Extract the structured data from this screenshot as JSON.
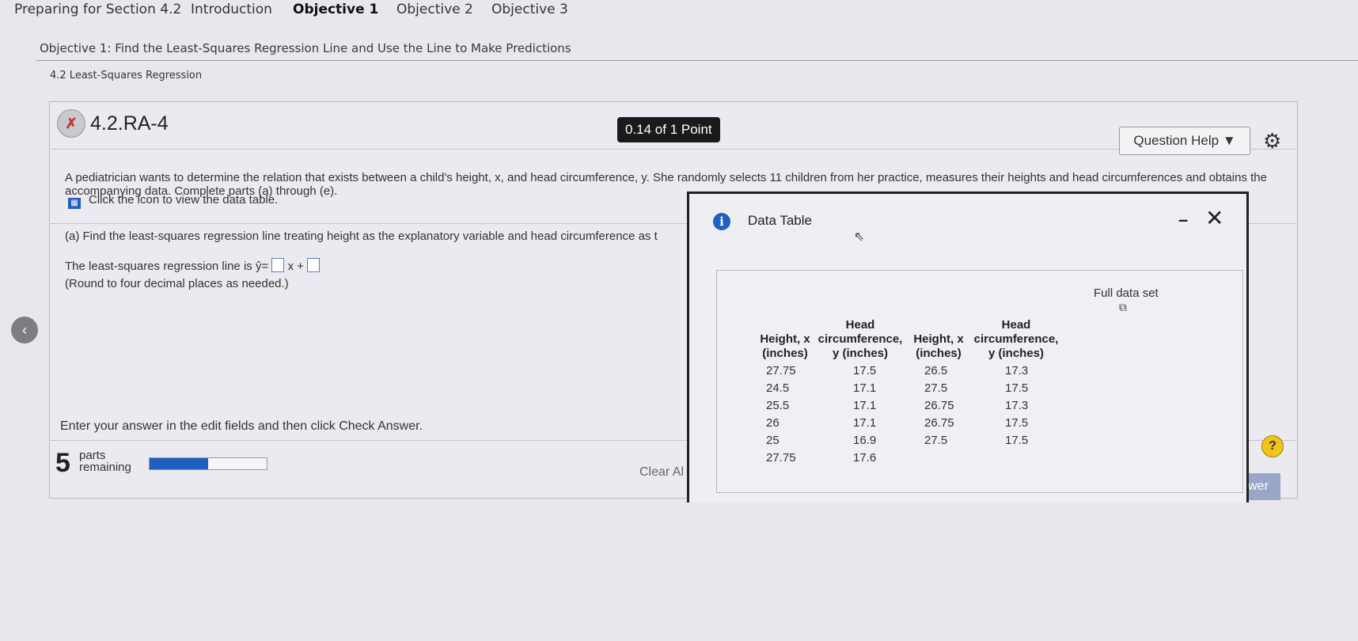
{
  "nav": {
    "tabs": [
      "Preparing for Section 4.2",
      "Introduction",
      "Objective 1",
      "Objective 2",
      "Objective 3"
    ],
    "active_tab": "Objective 1"
  },
  "objective_title": "Objective 1: Find the Least-Squares Regression Line and Use the Line to Make Predictions",
  "section_label": "4.2 Least-Squares Regression",
  "question": {
    "id": "4.2.RA-4",
    "points": "0.14 of 1 Point",
    "help_label": "Question Help",
    "prompt": "A pediatrician wants to determine the relation that exists between a child's height, x, and head circumference, y. She randomly selects 11 children from her practice, measures their heights and head circumferences and obtains the accompanying data. Complete parts (a) through (e).",
    "data_table_link": "Click the icon to view the data table.",
    "part_a": "(a) Find the least-squares regression line treating height as the explanatory variable and head circumference as t",
    "reg_line_prefix": "The least-squares regression line is",
    "yhat": "ŷ",
    "eq_sign": "=",
    "x_plus": "x +",
    "round_note": "(Round to four decimal places as needed.)",
    "enter_answer": "Enter your answer in the edit fields and then click Check Answer.",
    "parts_count": "5",
    "parts_label_1": "parts",
    "parts_label_2": "remaining",
    "progress": 0.5,
    "clear_all": "Clear Al",
    "check_partial": "wer",
    "help_symbol": "?"
  },
  "modal": {
    "title": "Data Table",
    "full_data_set": "Full data set",
    "headers": {
      "h1": [
        "Height, x",
        "(inches)"
      ],
      "h2": [
        "Head",
        "circumference,",
        "y (inches)"
      ],
      "h3": [
        "Height, x",
        "(inches)"
      ],
      "h4": [
        "Head",
        "circumference,",
        "y (inches)"
      ]
    },
    "left_x": [
      "27.75",
      "24.5",
      "25.5",
      "26",
      "25",
      "27.75"
    ],
    "left_y": [
      "17.5",
      "17.1",
      "17.1",
      "17.1",
      "16.9",
      "17.6"
    ],
    "right_x": [
      "26.5",
      "27.5",
      "26.75",
      "26.75",
      "27.5"
    ],
    "right_y": [
      "17.3",
      "17.5",
      "17.3",
      "17.5",
      "17.5"
    ]
  },
  "colors": {
    "accent_blue": "#1f5fbf",
    "points_badge": "#1a1a1a",
    "help_yellow": "#f0c419"
  },
  "icons": [
    "partial-credit-icon",
    "gear-icon",
    "data-table-icon",
    "info-icon",
    "minimize-icon",
    "close-icon",
    "copy-icon",
    "previous-arrow-icon",
    "help-icon",
    "cursor-icon"
  ]
}
